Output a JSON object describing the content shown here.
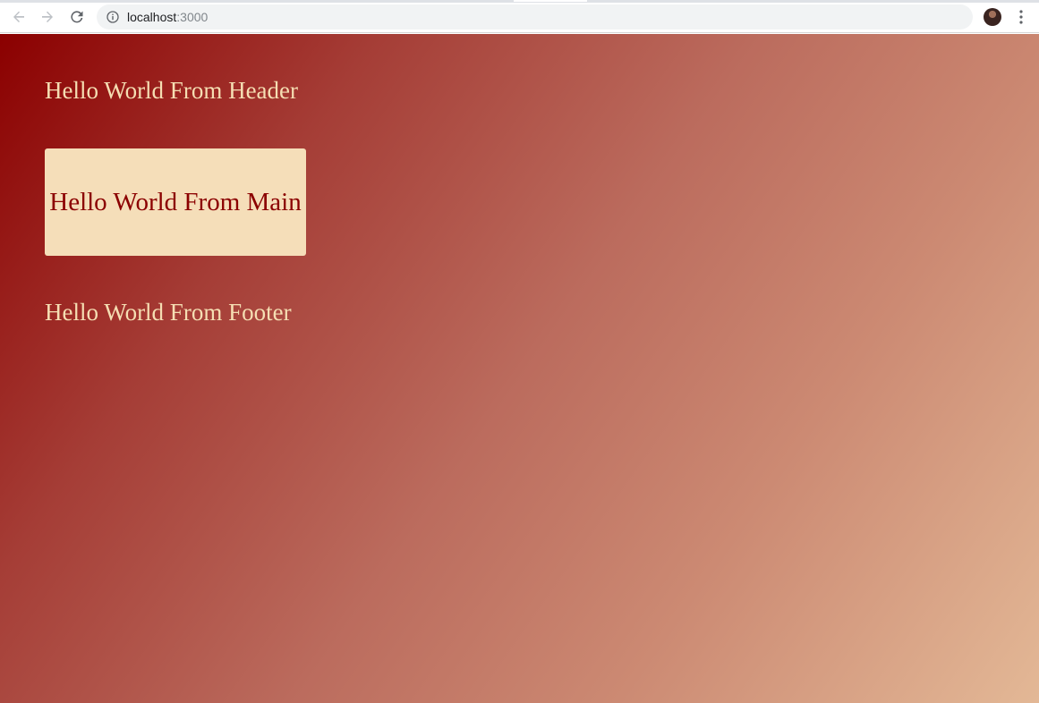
{
  "browser": {
    "back_icon": "arrow-left-icon",
    "forward_icon": "arrow-right-icon",
    "reload_icon": "reload-icon",
    "info_icon": "info-icon",
    "url_host": "localhost",
    "url_port": ":3000",
    "bookmark_icon": "star-icon",
    "menu_icon": "kebab-menu-icon"
  },
  "page": {
    "header_text": "Hello World From Header",
    "main_text": "Hello World From Main",
    "footer_text": "Hello World From Footer"
  },
  "colors": {
    "gradient_start": "#8b0000",
    "gradient_end": "#e3b896",
    "text_light": "#f5deb3",
    "card_background": "#f5deb9",
    "card_text": "#8b0000"
  }
}
